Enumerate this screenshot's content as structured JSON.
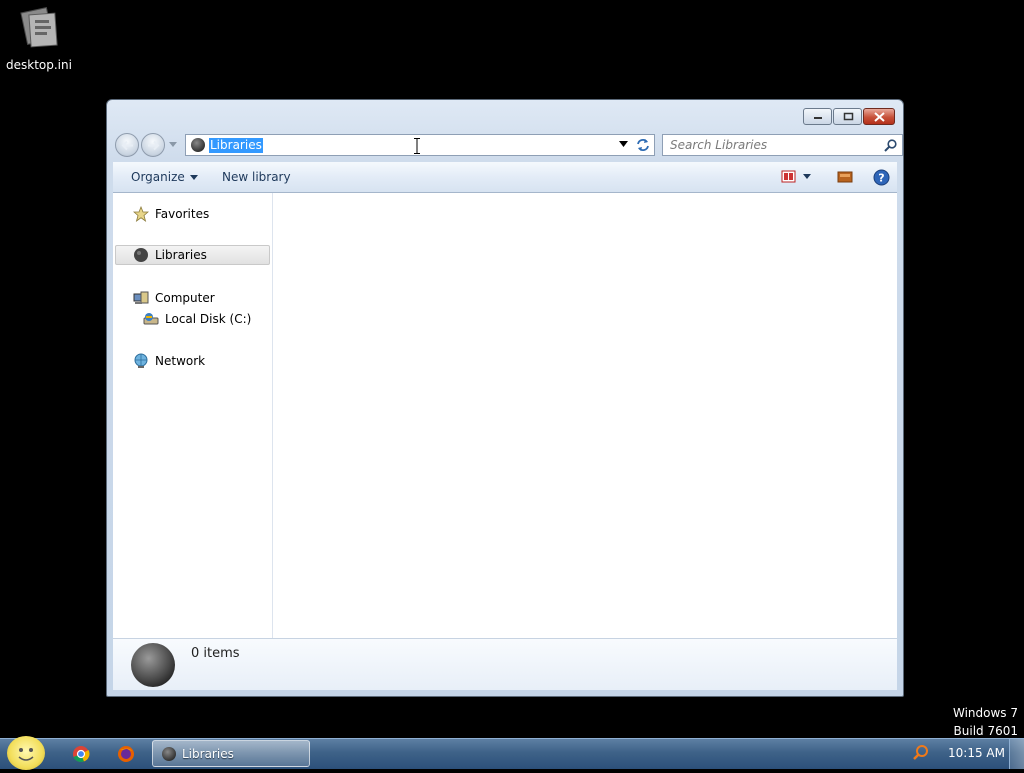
{
  "desktop": {
    "icon_label": "desktop.ini"
  },
  "window": {
    "address": {
      "location": "Libraries"
    },
    "search": {
      "placeholder": "Search Libraries"
    },
    "toolbar": {
      "organize_label": "Organize",
      "new_library_label": "New library"
    },
    "nav_pane": {
      "items": [
        {
          "label": "Favorites",
          "icon": "star-icon"
        },
        {
          "label": "Libraries",
          "icon": "libraries-icon",
          "selected": true
        },
        {
          "label": "Computer",
          "icon": "computer-icon"
        },
        {
          "label": "Local Disk (C:)",
          "icon": "drive-icon"
        },
        {
          "label": "Network",
          "icon": "network-icon"
        }
      ]
    },
    "details": {
      "item_count": "0 items"
    }
  },
  "watermark": {
    "line1": "Windows 7",
    "line2": "Build 7601"
  },
  "taskbar": {
    "task_label": "Libraries",
    "clock": "10:15 AM"
  },
  "colors": {
    "selection": "#3399ff",
    "taskbar": "#3e6288",
    "desktop": "#000000"
  }
}
